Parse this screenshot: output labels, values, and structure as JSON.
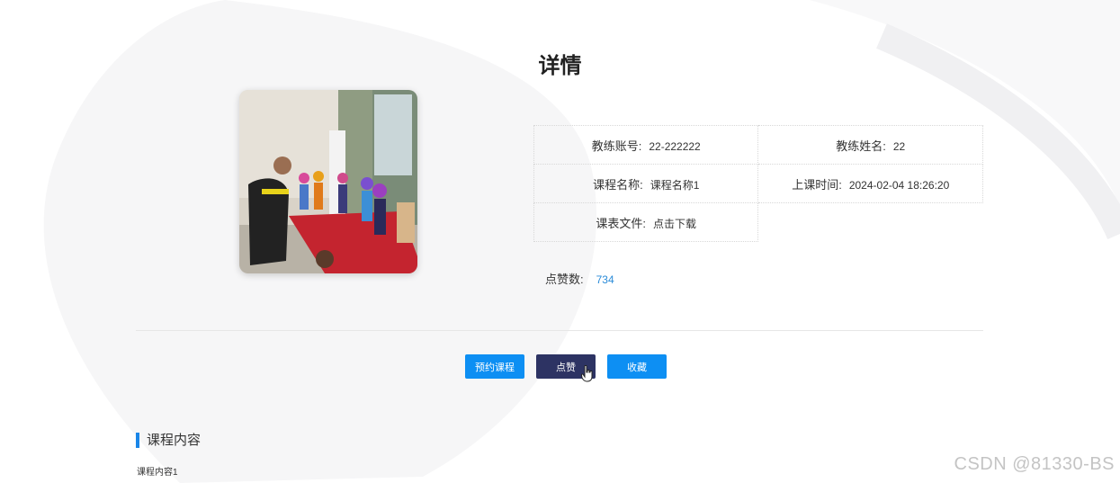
{
  "page_title": "详情",
  "details": {
    "coach_account_label": "教练账号:",
    "coach_account_value": "22-222222",
    "coach_name_label": "教练姓名:",
    "coach_name_value": "22",
    "course_name_label": "课程名称:",
    "course_name_value": "课程名称1",
    "class_time_label": "上课时间:",
    "class_time_value": "2024-02-04 18:26:20",
    "schedule_file_label": "课表文件:",
    "schedule_file_value": "点击下载"
  },
  "likes": {
    "label": "点赞数:",
    "value": "734"
  },
  "actions": {
    "book_label": "预约课程",
    "like_label": "点赞",
    "favorite_label": "收藏"
  },
  "content_section": {
    "title": "课程内容",
    "body": "课程内容1"
  },
  "watermark": "CSDN @81330-BS",
  "colors": {
    "primary_button": "#0d8ff3",
    "active_button": "#2d3363",
    "link": "#2a8bd8",
    "accent_bar": "#1a86e8"
  }
}
